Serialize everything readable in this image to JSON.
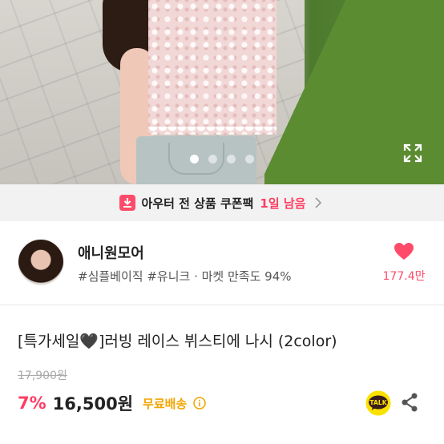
{
  "hero": {
    "image_alt": "product photo - pink lace sleeveless top",
    "carousel_dots": 4,
    "active_dot": 0,
    "expand_icon": "expand-icon"
  },
  "coupon": {
    "icon": "coupon-icon",
    "text": "아우터 전 상품 쿠폰팩",
    "remaining": "1일 남음",
    "chevron": "chevron-right-icon"
  },
  "store": {
    "name": "애니원모어",
    "tags": "#심플베이직 #유니크 · 마켓 만족도 94%",
    "like_icon": "heart-icon",
    "like_count": "177.4만",
    "like_color": "#ff4b6a"
  },
  "product": {
    "title": "[특가세일🖤]러빙 레이스 뷔스티에 나시 (2color)",
    "original_price": "17,900원",
    "discount": "7%",
    "price": "16,500원",
    "shipping": "무료배송",
    "accent_color": "#ff3d62",
    "shipping_color": "#f0a500"
  },
  "actions": {
    "talk_label": "TALK",
    "share_icon": "share-icon"
  }
}
